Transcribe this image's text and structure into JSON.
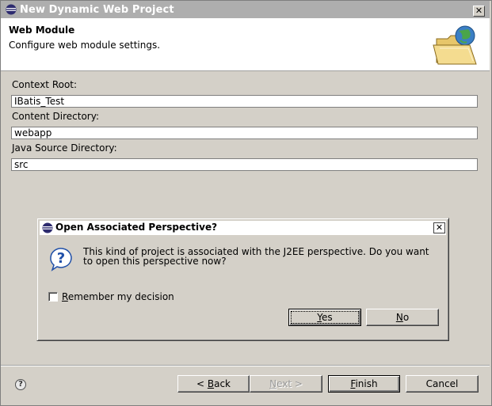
{
  "window": {
    "title": "New Dynamic Web Project",
    "close_glyph": "✕",
    "icon": "eclipse-icon"
  },
  "header": {
    "title": "Web Module",
    "description": "Configure web module settings.",
    "icon": "web-folder-globe-icon"
  },
  "fields": [
    {
      "label": "Context Root:",
      "value": "IBatis_Test"
    },
    {
      "label": "Content Directory:",
      "value": "webapp"
    },
    {
      "label": "Java Source Directory:",
      "value": "src"
    }
  ],
  "footer": {
    "help_glyph": "?",
    "buttons": {
      "back": {
        "prefix": "< ",
        "mnemonic": "B",
        "rest": "ack"
      },
      "next": {
        "mnemonic": "N",
        "rest": "ext >"
      },
      "finish": {
        "mnemonic": "F",
        "rest": "inish"
      },
      "cancel": {
        "label": "Cancel"
      }
    }
  },
  "dialog": {
    "title": "Open Associated Perspective?",
    "close_glyph": "✕",
    "message": "This kind of project is associated with the J2EE perspective.  Do you want to open this perspective now?",
    "checkbox": {
      "mnemonic": "R",
      "rest": "emember my decision",
      "checked": false
    },
    "buttons": {
      "yes": {
        "mnemonic": "Y",
        "rest": "es"
      },
      "no": {
        "mnemonic": "N",
        "rest": "o"
      }
    }
  },
  "colors": {
    "titlebar_inactive": "#aeaeae",
    "dialog_face": "#d4d0c8",
    "header_bg": "#ffffff"
  }
}
